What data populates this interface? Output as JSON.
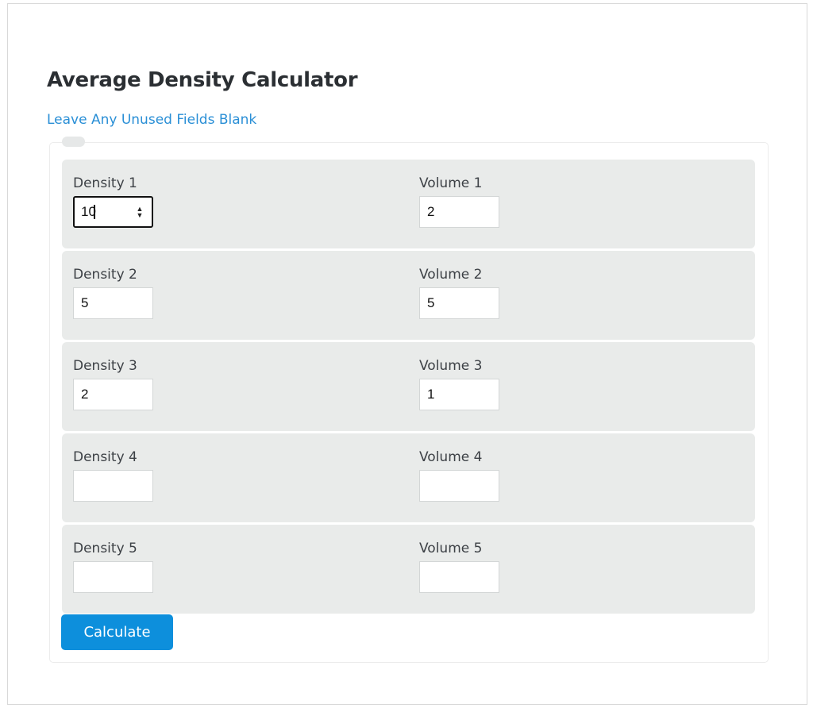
{
  "calculator": {
    "title": "Average Density Calculator",
    "subtitle": "Leave Any Unused Fields Blank",
    "rows": [
      {
        "density_label": "Density 1",
        "density_value": "10",
        "volume_label": "Volume 1",
        "volume_value": "2"
      },
      {
        "density_label": "Density 2",
        "density_value": "5",
        "volume_label": "Volume 2",
        "volume_value": "5"
      },
      {
        "density_label": "Density 3",
        "density_value": "2",
        "volume_label": "Volume 3",
        "volume_value": "1"
      },
      {
        "density_label": "Density 4",
        "density_value": "",
        "volume_label": "Volume 4",
        "volume_value": ""
      },
      {
        "density_label": "Density 5",
        "density_value": "",
        "volume_label": "Volume 5",
        "volume_value": ""
      }
    ],
    "button_label": "Calculate",
    "focused_field": "density-1-input",
    "spinner_icon": "up-down-arrows-icon"
  },
  "colors": {
    "accent": "#0d8fdc",
    "link": "#2a8fd6",
    "row_background": "#e9ebea",
    "title": "#2b2f33"
  }
}
